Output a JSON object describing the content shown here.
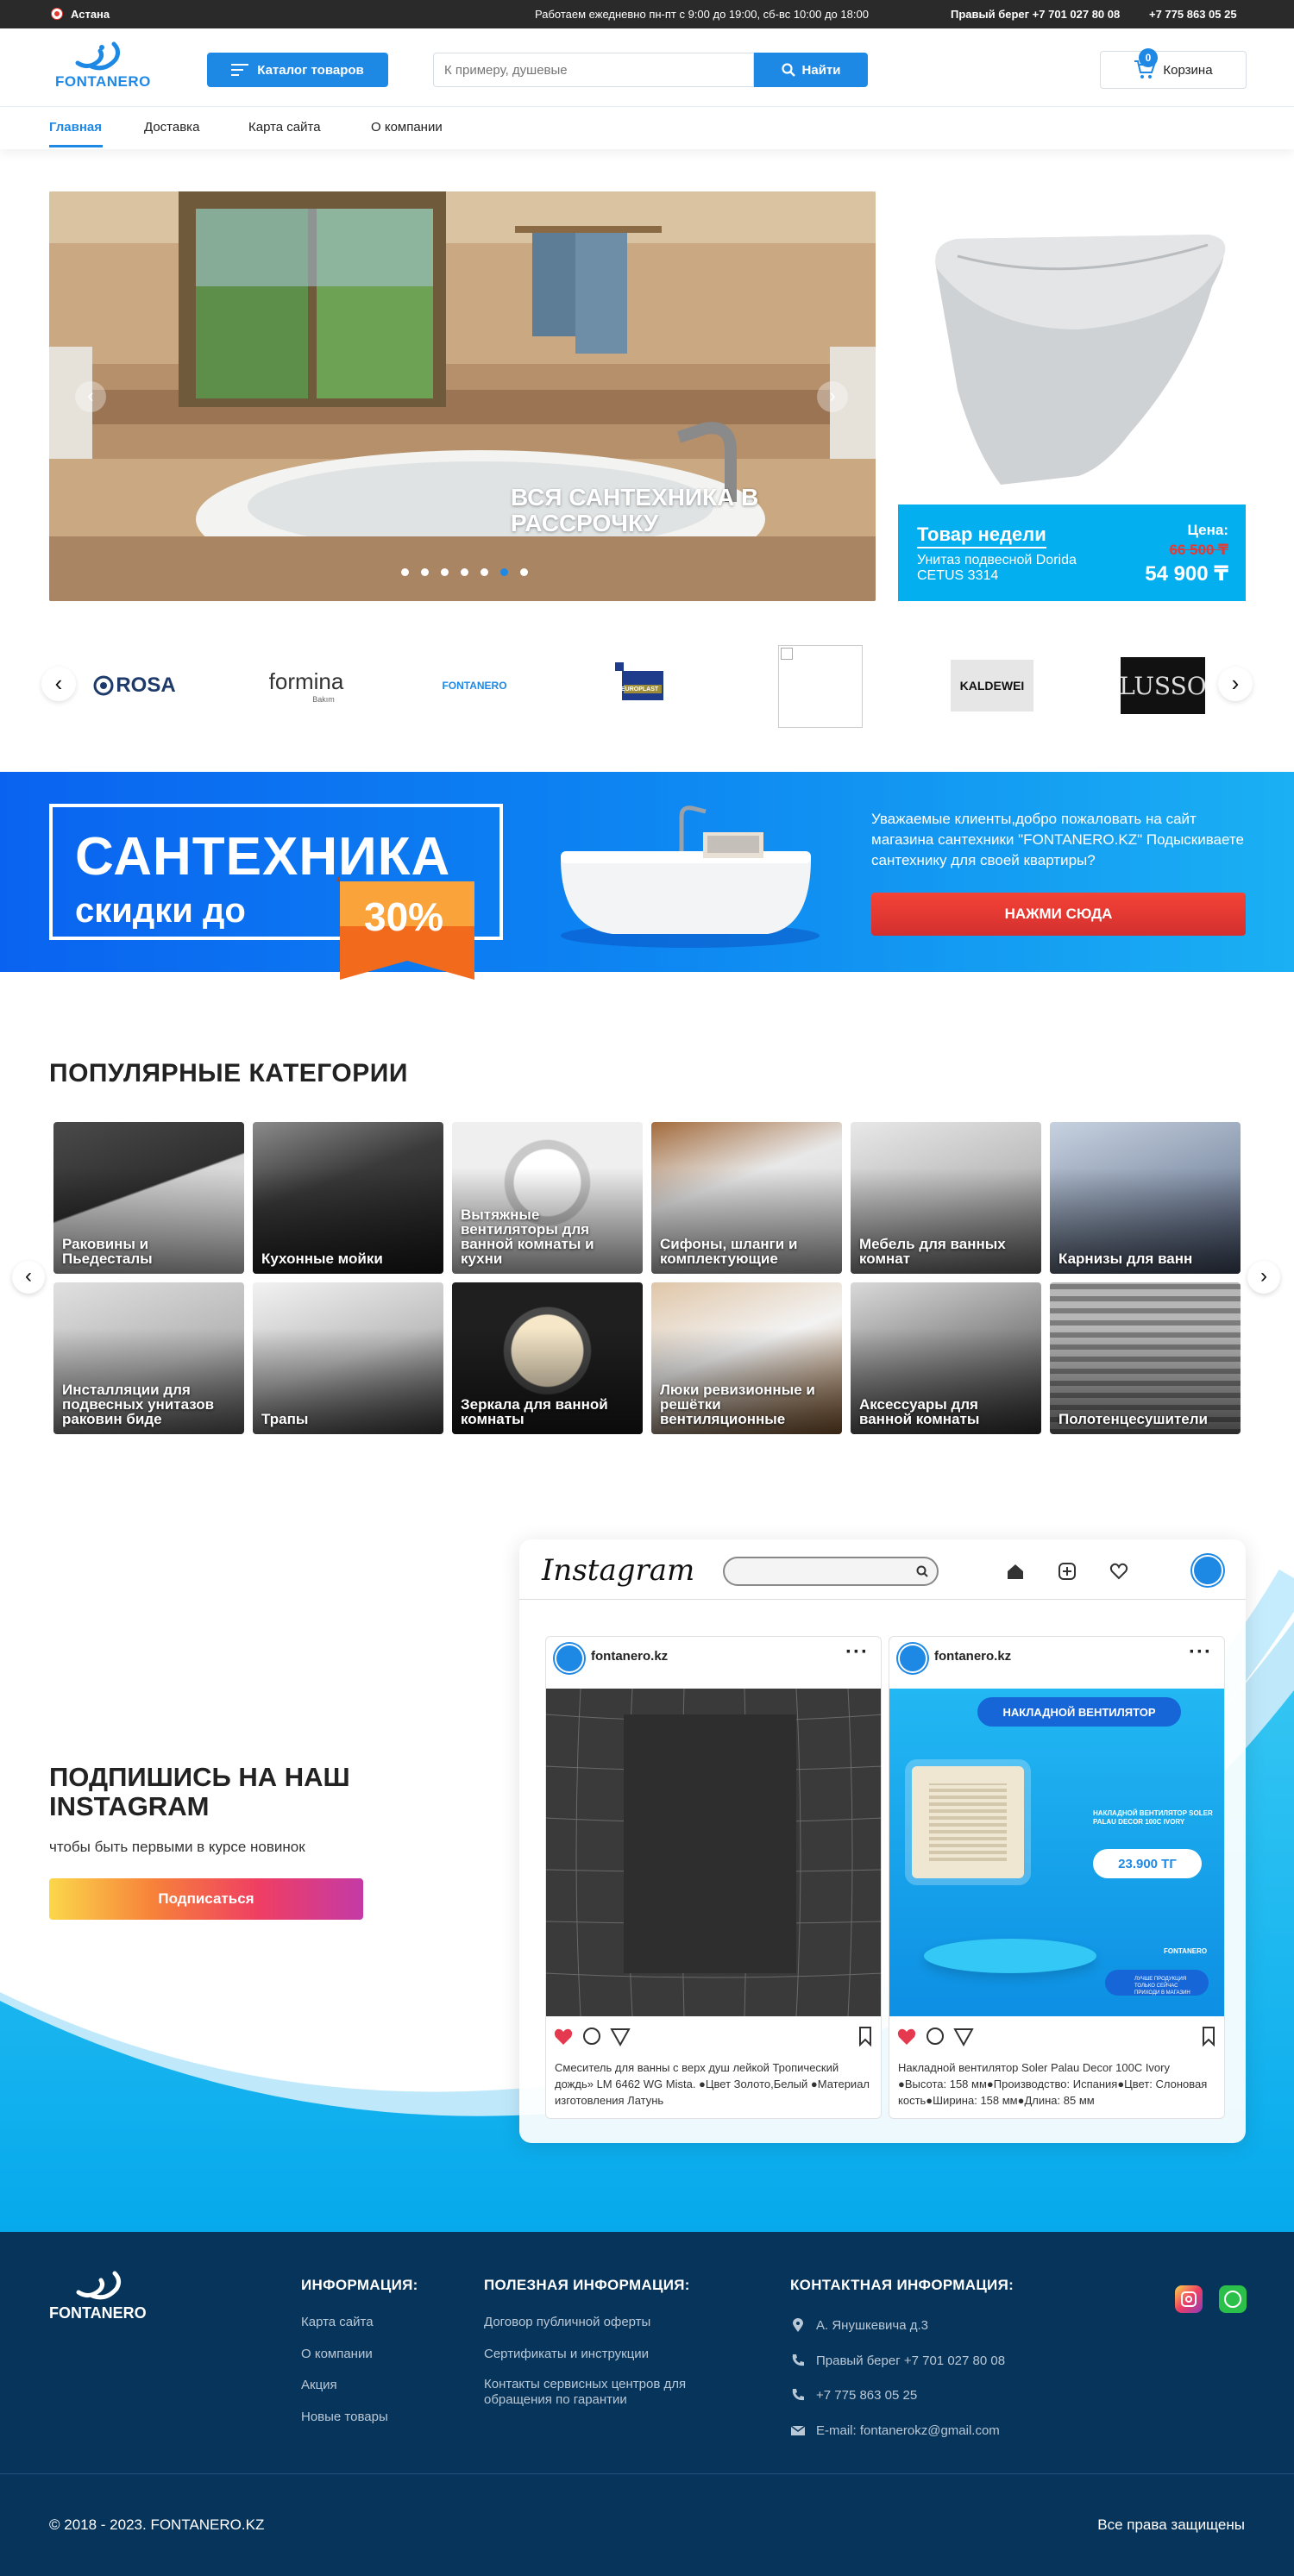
{
  "topbar": {
    "city": "Астана",
    "hours": "Работаем ежедневно пн-пт с 9:00 до 19:00, сб-вс 10:00 до 18:00",
    "phone1": "Правый берег +7 701 027 80 08",
    "phone2": "+7 775 863 05 25"
  },
  "header": {
    "logo_text": "FONTANERO",
    "catalog_label": "Каталог товаров",
    "search_placeholder": "К примеру, душевые",
    "search_button": "Найти",
    "cart_label": "Корзина",
    "cart_count": "0"
  },
  "nav": {
    "items": [
      "Главная",
      "Доставка",
      "Карта сайта",
      "О компании"
    ]
  },
  "hero": {
    "text": "ВСЯ САНТЕХНИКА В РАССРОЧКУ",
    "slides_total": 7,
    "active_slide": 6
  },
  "product_of_week": {
    "title": "Товар недели",
    "name": "Унитаз подвесной Dorida CETUS 3314",
    "price_label": "Цена:",
    "old_price": "66 500 ₸",
    "new_price": "54 900 ₸"
  },
  "brands": {
    "items": [
      "ROSA",
      "formina",
      "FONTANERO",
      "EUROPLAST",
      "",
      "KALDEWEI",
      "LUSSO"
    ],
    "formina_sub": "Bakım"
  },
  "promo": {
    "line1": "САНТЕХНИКА",
    "line2": "скидки до",
    "percent": "30%",
    "text": "Уважаемые клиенты,добро пожаловать на сайт магазина сантехники \"FONTANERO.KZ\" Подыскиваете сантехнику для своей квартиры?",
    "button": "НАЖМИ СЮДА"
  },
  "categories": {
    "title": "ПОПУЛЯРНЫЕ КАТЕГОРИИ",
    "items": [
      "Раковины и Пьедесталы",
      "Кухонные мойки",
      "Вытяжные вентиляторы для ванной комнаты и кухни",
      "Сифоны, шланги и комплектующие",
      "Мебель для ванных комнат",
      "Карнизы для ванн",
      "Инсталляции для подвесных унитазов раковин биде",
      "Трапы",
      "Зеркала для ванной комнаты",
      "Люки ревизионные и решётки вентиляционные",
      "Аксессуары для ванной комнаты",
      "Полотенцесушители"
    ]
  },
  "instagram": {
    "heading": "ПОДПИШИСЬ НА НАШ INSTAGRAM",
    "sub": "чтобы быть первыми в курсе новинок",
    "button": "Подписаться",
    "app_logo": "Instagram",
    "posts": [
      {
        "user": "fontanero.kz",
        "caption": "Смеситель для ванны с верх душ лейкой Тропический дождь» LM 6462 WG Mista. ●Цвет Золото,Белый ●Материал изготовления Латунь"
      },
      {
        "user": "fontanero.kz",
        "caption": "Накладной вентилятор Soler Palau Decor 100C Ivory ●Высота: 158 мм●Производство: Испания●Цвет: Слоновая кость●Ширина: 158 мм●Длина: 85 мм",
        "banner": "НАКЛАДНОЙ ВЕНТИЛЯТОР",
        "promo_title": "НАКЛАДНОЙ ВЕНТИЛЯТОР SOLER PALAU DECOR 100C IVORY",
        "price": "23.900 ТГ",
        "brand": "FONTANERO",
        "guarantee": "ЛУЧШЕ ПРОДУКЦИЯ ТОЛЬКО СЕЙЧАС ПРИХОДИ В МАГАЗИН"
      }
    ]
  },
  "footer": {
    "logo_text": "FONTANERO",
    "info_title": "ИНФОРМАЦИЯ:",
    "info_links": [
      "Карта сайта",
      "О компании",
      "Акция",
      "Новые товары"
    ],
    "useful_title": "ПОЛЕЗНАЯ ИНФОРМАЦИЯ:",
    "useful_links": [
      "Договор публичной оферты",
      "Сертификаты и инструкции",
      "Контакты сервисных центров для обращения по гарантии"
    ],
    "contact_title": "КОНТАКТНАЯ ИНФОРМАЦИЯ:",
    "address": "А. Янушкевича д.3",
    "phone1": "Правый берег +7 701 027 80 08",
    "phone2": "+7 775 863 05 25",
    "email": "E-mail: fontanerokz@gmail.com",
    "copyright": "© 2018 - 2023. FONTANERO.KZ",
    "rights": "Все права защищены"
  },
  "colors": {
    "accent": "#1e88e5",
    "topbar": "#2a2a2a",
    "footer": "#07345a",
    "promo_button": "#e53935",
    "week_bg": "#04aff0"
  }
}
